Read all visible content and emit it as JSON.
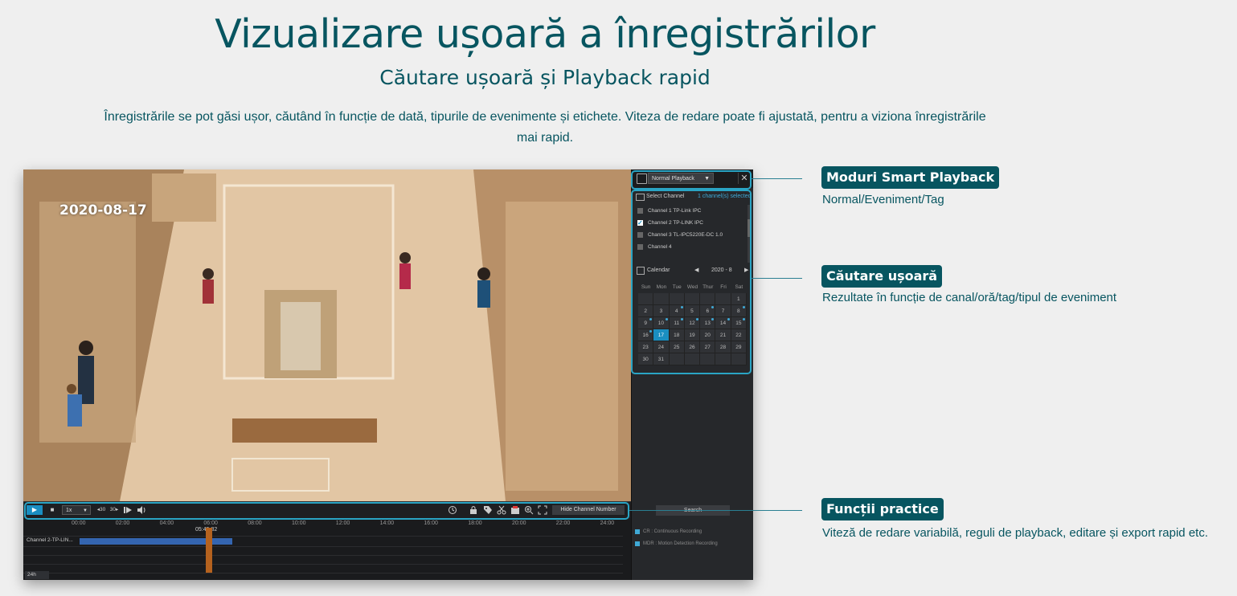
{
  "header": {
    "title": "Vizualizare ușoară a înregistrărilor",
    "subtitle": "Căutare ușoară și Playback rapid",
    "description": "Înregistrările se pot găsi ușor, căutând în funcție de dată, tipurile de evenimente și etichete. Viteza de redare poate fi ajustată, pentru a viziona înregistrările mai rapid."
  },
  "video": {
    "date_overlay": "2020-08-17"
  },
  "sidebar": {
    "mode": "Normal Playback",
    "close_symbol": "✕",
    "select_channel_label": "Select Channel",
    "channel_count": "1 channel(s) selected",
    "channels": [
      {
        "label": "Channel 1 TP-Link IPC",
        "checked": false
      },
      {
        "label": "Channel 2 TP-LINK IPC",
        "checked": true
      },
      {
        "label": "Channel 3 TL-IPC5220E-DC 1.0",
        "checked": false
      },
      {
        "label": "Channel 4",
        "checked": false
      }
    ],
    "calendar_label": "Calendar",
    "calendar_prev": "◀",
    "calendar_month": "2020 - 8",
    "calendar_next": "▶",
    "weekdays": [
      "Sun",
      "Mon",
      "Tue",
      "Wed",
      "Thur",
      "Fri",
      "Sat"
    ],
    "weeks": [
      [
        "",
        "",
        "",
        "",
        "",
        "",
        "1"
      ],
      [
        "2",
        "3",
        "4",
        "5",
        "6",
        "7",
        "8"
      ],
      [
        "9",
        "10",
        "11",
        "12",
        "13",
        "14",
        "15"
      ],
      [
        "16",
        "17",
        "18",
        "19",
        "20",
        "21",
        "22"
      ],
      [
        "23",
        "24",
        "25",
        "26",
        "27",
        "28",
        "29"
      ],
      [
        "30",
        "31",
        "",
        "",
        "",
        "",
        ""
      ]
    ],
    "marked_days": [
      "4",
      "6",
      "8",
      "9",
      "10",
      "11",
      "12",
      "13",
      "14",
      "15",
      "16"
    ],
    "selected_day": "17",
    "search_label": "Search",
    "legend": [
      "CR : Continuous Recording",
      "MDR : Motion Detection Recording"
    ]
  },
  "controls": {
    "play_symbol": "▶",
    "stop_symbol": "■",
    "speed": "1x",
    "speed_caret": "▼",
    "back30": "◂30",
    "fwd30": "30▸",
    "hide_channel_label": "Hide Channel Number"
  },
  "timeline": {
    "ticks": [
      "00:00",
      "02:00",
      "04:00",
      "06:00",
      "08:00",
      "10:00",
      "12:00",
      "14:00",
      "16:00",
      "18:00",
      "20:00",
      "22:00",
      "24:00"
    ],
    "current_time": "05:45:32",
    "track_label": "Channel 2-TP-LIN...",
    "zoom": "24h"
  },
  "callouts": [
    {
      "title": "Moduri Smart Playback",
      "desc": "Normal/Eveniment/Tag"
    },
    {
      "title": "Căutare ușoară",
      "desc": "Rezultate în funcție de canal/oră/tag/tipul de eveniment"
    },
    {
      "title": "Funcții practice",
      "desc": "Viteză de redare variabilă, reguli de playback, editare și export rapid etc."
    }
  ],
  "colors": {
    "brand": "#075560",
    "accent": "#1a8ec1",
    "highlight": "#2aa4c4"
  }
}
